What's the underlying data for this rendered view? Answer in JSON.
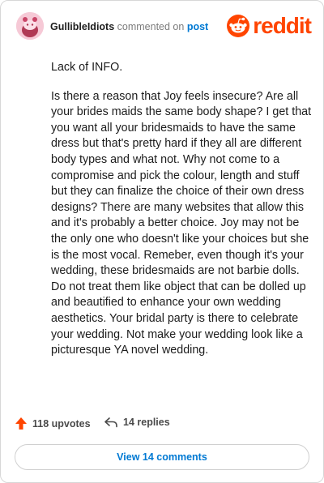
{
  "comment": {
    "username": "GullibleIdiots",
    "action_text": "commented on",
    "target_link": "post",
    "paragraphs": [
      "Lack of INFO.",
      "Is there a reason that Joy feels insecure? Are all your brides maids the same body shape? I get that you want all your bridesmaids to have the same dress but that's pretty hard if they all are different body types and what not. Why not come to a compromise and pick the colour, length and stuff but they can finalize the choice of their own dress designs? There are many websites that allow this and it's probably a better choice. Joy may not be the only one who doesn't like your choices but she is the most vocal. Remeber, even though it's your wedding, these bridesmaids are not barbie dolls. Do not treat them like object that can be dolled up and beautified to enhance your own wedding aesthetics. Your bridal party is there to celebrate your wedding. Not make your wedding look like a picturesque YA novel wedding."
    ]
  },
  "brand": {
    "wordmark": "reddit",
    "color": "#ff4500",
    "icon": "reddit-snoo-icon"
  },
  "actions": {
    "upvotes": "118 upvotes",
    "replies": "14 replies",
    "upvote_icon": "upvote-arrow-icon",
    "reply_icon": "reply-arrow-icon",
    "upvote_color": "#ff4500"
  },
  "view_button": {
    "label": "View 14 comments",
    "color": "#0079d3"
  }
}
